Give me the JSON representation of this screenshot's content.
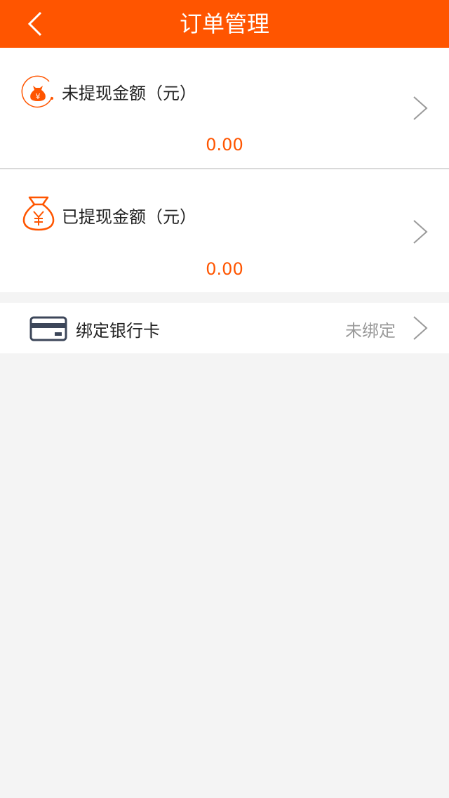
{
  "header": {
    "title": "订单管理",
    "back_icon": "chevron-left-icon",
    "bg_color": "#ff5500"
  },
  "unwithdrawn": {
    "icon": "money-bag-circle-icon",
    "label": "未提现金额（元）",
    "amount": "0.00"
  },
  "withdrawn": {
    "icon": "money-bag-icon",
    "label": "已提现金额（元）",
    "amount": "0.00"
  },
  "bank_card": {
    "icon": "credit-card-icon",
    "label": "绑定银行卡",
    "status": "未绑定"
  },
  "colors": {
    "accent": "#ff5500",
    "text": "#222222",
    "muted": "#9a9a9a",
    "background": "#f4f4f4"
  }
}
